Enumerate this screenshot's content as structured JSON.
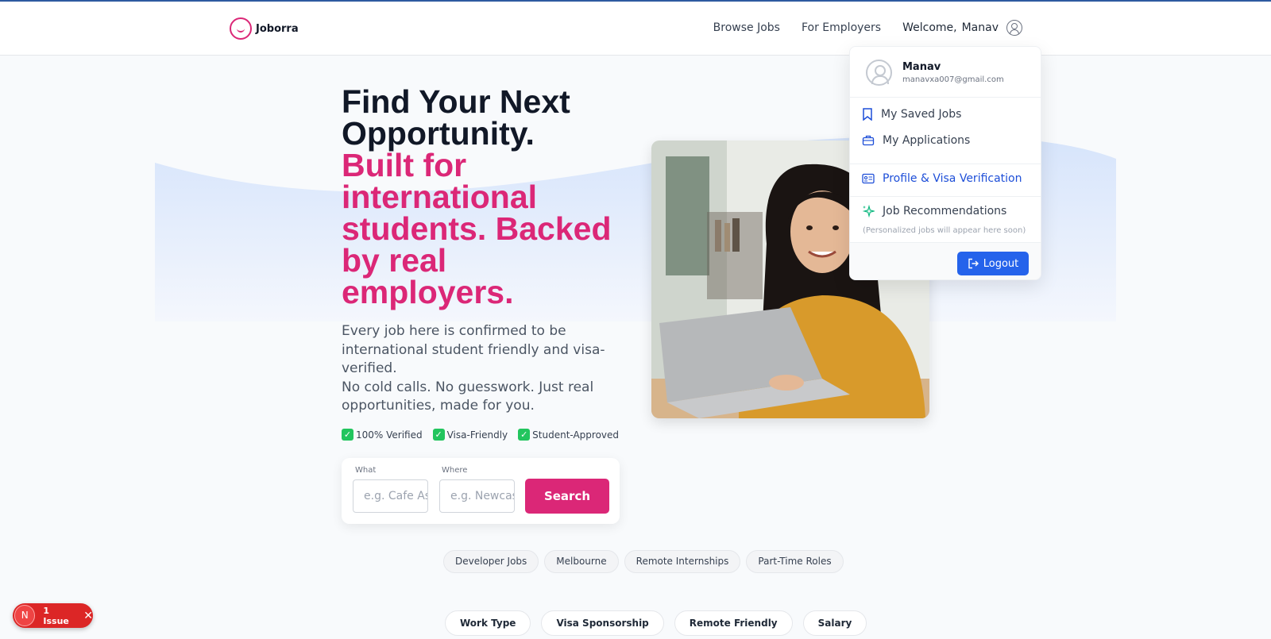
{
  "header": {
    "brand": "Joborra",
    "nav": {
      "browse": "Browse Jobs",
      "employers": "For Employers",
      "welcome": "Welcome,",
      "username": "Manav"
    }
  },
  "hero": {
    "title_dark_1": "Find Your Next",
    "title_dark_2": "Opportunity.",
    "title_pink_1": "Built for",
    "title_pink_2": "international",
    "title_pink_3": "students. Backed",
    "title_pink_4": "by real",
    "title_pink_5": "employers.",
    "desc_1": "Every job here is confirmed to be international student friendly and visa-verified.",
    "desc_2": "No cold calls. No guesswork. Just real opportunities, made for you.",
    "badges": [
      "100% Verified",
      "Visa-Friendly",
      "Student-Approved"
    ]
  },
  "search": {
    "what_label": "What",
    "what_placeholder": "e.g. Cafe Assistant",
    "where_label": "Where",
    "where_placeholder": "e.g. Newcastle",
    "button": "Search"
  },
  "chips": [
    "Developer Jobs",
    "Melbourne",
    "Remote Internships",
    "Part-Time Roles"
  ],
  "filters": [
    "Work Type",
    "Visa Sponsorship",
    "Remote Friendly",
    "Salary"
  ],
  "issue": {
    "badge": "N",
    "text": "1 Issue",
    "close": "✕"
  },
  "dropdown": {
    "name": "Manav",
    "email": "manavxa007@gmail.com",
    "saved": "My Saved Jobs",
    "applications": "My Applications",
    "profile": "Profile & Visa Verification",
    "recommendations": "Job Recommendations",
    "recommendations_note": "(Personalized jobs will appear here soon)",
    "logout": "Logout"
  },
  "colors": {
    "accent_pink": "#db2777",
    "accent_blue": "#2563eb",
    "wave": "#dbe7fb"
  }
}
